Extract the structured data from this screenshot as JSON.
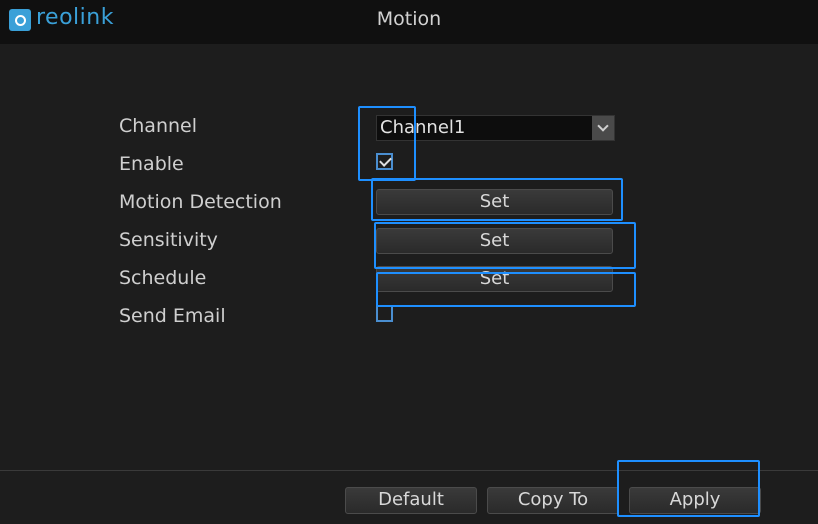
{
  "app": {
    "brand": "reolink",
    "title": "Motion"
  },
  "form": {
    "channel": {
      "label": "Channel",
      "value": "Channel1"
    },
    "enable": {
      "label": "Enable",
      "checked": true
    },
    "motion_detection": {
      "label": "Motion Detection",
      "button": "Set"
    },
    "sensitivity": {
      "label": "Sensitivity",
      "button": "Set"
    },
    "schedule": {
      "label": "Schedule",
      "button": "Set"
    },
    "send_email": {
      "label": "Send Email",
      "checked": false
    }
  },
  "footer": {
    "default_label": "Default",
    "copy_to_label": "Copy To",
    "apply_label": "Apply"
  },
  "colors": {
    "background": "#1d1d1d",
    "titlebar": "#101010",
    "brand": "#3aa0d8",
    "highlight": "#1e8fff"
  }
}
